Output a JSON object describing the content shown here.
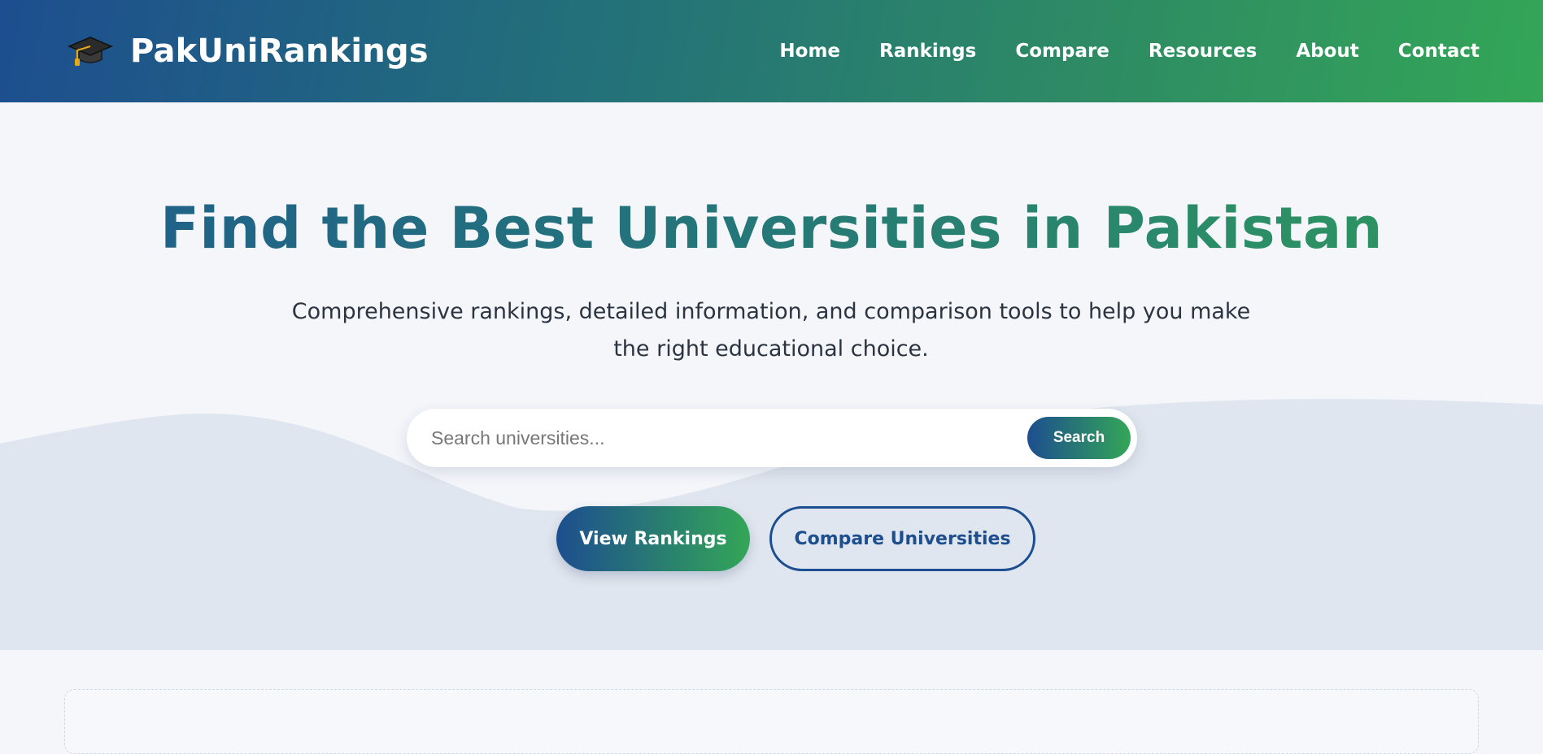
{
  "brand": {
    "name": "PakUniRankings",
    "icon": "graduation-cap-icon"
  },
  "nav": {
    "links": [
      "Home",
      "Rankings",
      "Compare",
      "Resources",
      "About",
      "Contact"
    ]
  },
  "hero": {
    "title": "Find the Best Universities in Pakistan",
    "subtitle": "Comprehensive rankings, detailed information, and comparison tools to help you make the right educational choice."
  },
  "search": {
    "placeholder": "Search universities...",
    "value": "",
    "button_label": "Search"
  },
  "cta": {
    "primary_label": "View Rankings",
    "secondary_label": "Compare Universities"
  },
  "colors": {
    "primary_blue": "#1d4e8f",
    "primary_green": "#33a657",
    "background": "#f4f6fa",
    "wave": "#e0e6ef"
  }
}
